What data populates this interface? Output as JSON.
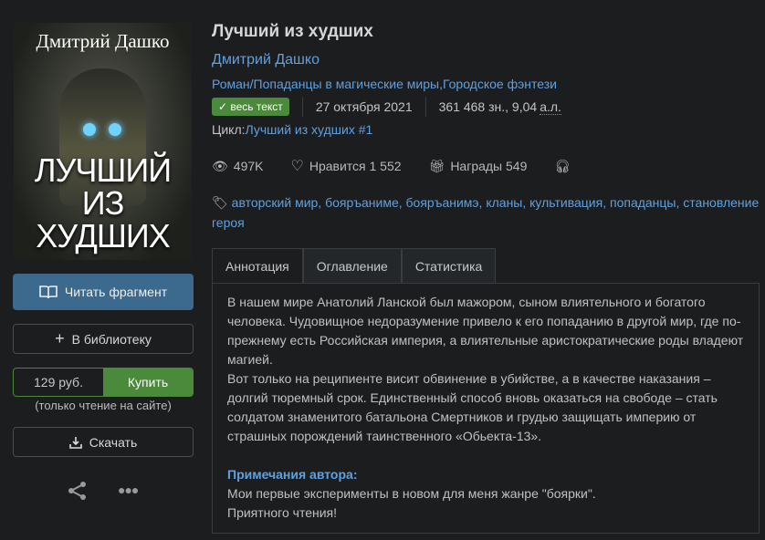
{
  "cover": {
    "author": "Дмитрий Дашко",
    "title_line1": "ЛУЧШИЙ",
    "title_line2": "ИЗ ХУДШИХ"
  },
  "sidebar": {
    "read_fragment": "Читать фрагмент",
    "add_library": "В библиотеку",
    "price": "129 руб.",
    "buy": "Купить",
    "buy_note": "(только чтение на сайте)",
    "download": "Скачать"
  },
  "book": {
    "title": "Лучший из худших",
    "author": "Дмитрий Дашко",
    "genre_form": "Роман",
    "genre_sep": " / ",
    "genres": [
      "Попаданцы в магические миры",
      ", ",
      "Городское фэнтези"
    ],
    "status_badge": "весь текст",
    "date": "27 октября 2021",
    "size": "361 468 зн., 9,04 ",
    "size_unit": "а.л.",
    "cycle_label": "Цикл: ",
    "cycle": "Лучший из худших #1",
    "views": "497K",
    "likes": "Нравится 1 552",
    "awards": "Награды 549",
    "tags": "авторский мир, бояръаниме, бояръанимэ, кланы, культивация, попаданцы, становление героя"
  },
  "tabs": [
    "Аннотация",
    "Оглавление",
    "Статистика"
  ],
  "annotation": {
    "p1": "В нашем мире Анатолий Ланской был мажором, сыном влиятельного и богатого человека. Чудовищное недоразумение привело к его попаданию в другой мир, где по-прежнему есть Российская империя, а влиятельные аристократические роды владеют магией.",
    "p2": "Вот только на реципиенте висит обвинение в убийстве, а в качестве наказания – долгий тюремный срок. Единственный способ вновь оказаться на свободе – стать солдатом знаменитого батальона Смертников и грудью защищать империю от страшных порождений таинственного «Обьекта-13».",
    "notes_title": "Примечания автора:",
    "notes1": "Мои первые эксперименты в новом для меня жанре \"боярки\".",
    "notes2": "Приятного чтения!"
  }
}
